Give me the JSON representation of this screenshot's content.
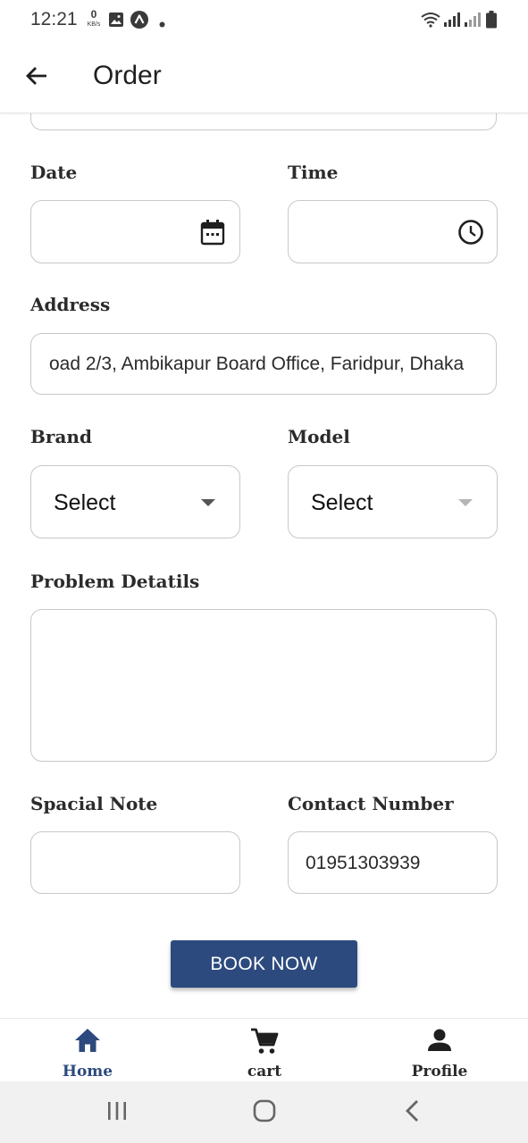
{
  "status_bar": {
    "time": "12:21",
    "data_rate_value": "0",
    "data_rate_unit": "KB/s",
    "icons": [
      "image-icon",
      "app-badge-icon",
      "dot-icon",
      "wifi-icon",
      "signal-icon",
      "signal-icon-2",
      "battery-icon"
    ]
  },
  "app_bar": {
    "title": "Order",
    "back_icon": "arrow-left-icon"
  },
  "form": {
    "date": {
      "label": "Date",
      "value": "",
      "icon": "calendar-icon"
    },
    "time": {
      "label": "Time",
      "value": "",
      "icon": "clock-icon"
    },
    "address": {
      "label": "Address",
      "value": "oad 2/3, Ambikapur Board Office, Faridpur, Dhaka"
    },
    "brand": {
      "label": "Brand",
      "selected": "Select"
    },
    "model": {
      "label": "Model",
      "selected": "Select"
    },
    "problem_details": {
      "label": "Problem Detatils",
      "value": ""
    },
    "special_note": {
      "label": "Spacial Note",
      "value": ""
    },
    "contact_number": {
      "label": "Contact Number",
      "value": "01951303939"
    },
    "submit_label": "BOOK NOW"
  },
  "bottom_nav": {
    "items": [
      {
        "label": "Home",
        "icon": "home-icon",
        "active": true
      },
      {
        "label": "cart",
        "icon": "cart-icon",
        "active": false
      },
      {
        "label": "Profile",
        "icon": "person-icon",
        "active": false
      }
    ]
  },
  "colors": {
    "accent": "#2c4a7e",
    "border": "#c8c8c8",
    "system_nav_bg": "#f1f1f1"
  }
}
